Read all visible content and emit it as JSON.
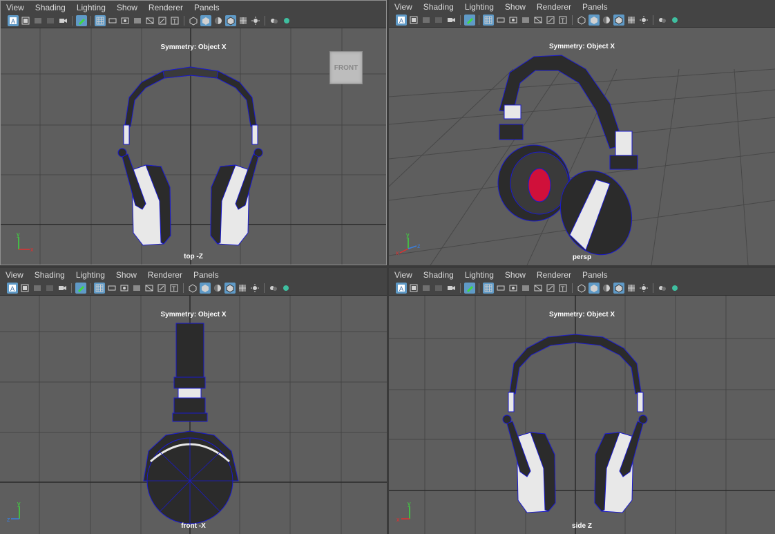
{
  "menus": [
    "View",
    "Shading",
    "Lighting",
    "Show",
    "Renderer",
    "Panels"
  ],
  "toolbar_icons": [
    "select-camera-icon",
    "camera-attributes-icon",
    "bookmark-icon",
    "image-plane-icon",
    "2d-pan-icon",
    "grease-pencil-icon",
    "grid-icon",
    "film-gate-icon",
    "resolution-gate-icon",
    "gate-mask-icon",
    "field-chart-icon",
    "safe-action-icon",
    "safe-title-icon",
    "wireframe-icon",
    "smooth-shade-icon",
    "xray-icon",
    "wireframe-on-shaded-icon",
    "textured-icon",
    "lighting-icon",
    "shadows-icon",
    "ambient-occlusion-icon"
  ],
  "panels": [
    {
      "symmetry": "Symmetry: Object X",
      "camera": "top -Z",
      "viewcube": "FRONT"
    },
    {
      "symmetry": "Symmetry: Object X",
      "camera": "persp"
    },
    {
      "symmetry": "Symmetry: Object X",
      "camera": "front -X"
    },
    {
      "symmetry": "Symmetry: Object X",
      "camera": "side Z"
    }
  ],
  "axis_labels": {
    "y": "y",
    "x": "x",
    "z": "z"
  },
  "colors": {
    "viewport_bg": "#5e5e5e",
    "grid": "#3f3f3f",
    "wire": "#1a1acf",
    "mesh_dark": "#2b2b2b",
    "mesh_light": "#e8e8e8",
    "ear_red": "#d0103a",
    "active_icon": "#5f9ac7"
  }
}
